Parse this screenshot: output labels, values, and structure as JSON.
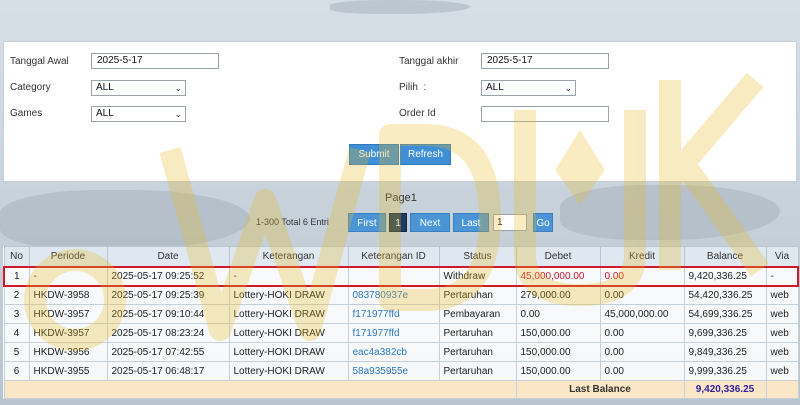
{
  "filters": {
    "start_date_label": "Tanggal Awal",
    "start_date_value": "2025-5-17",
    "end_date_label": "Tanggal akhir",
    "end_date_value": "2025-5-17",
    "category_label": "Category",
    "category_value": "ALL",
    "pilih_label": "Pilih  :",
    "pilih_value": "ALL",
    "games_label": "Games",
    "games_value": "ALL",
    "order_id_label": "Order Id",
    "order_id_value": "",
    "submit_label": "Submit",
    "refresh_label": "Refresh"
  },
  "pager": {
    "title": "Page1",
    "info": "1-300 Total 6 Entri",
    "first_label": "First",
    "current_page": "1",
    "next_label": "Next",
    "last_label": "Last",
    "goto_value": "1",
    "go_label": "Go"
  },
  "table": {
    "headers": [
      "No",
      "Periode",
      "Date",
      "Keterangan",
      "Keterangan ID",
      "Status",
      "Debet",
      "Kredit",
      "Balance",
      "Via"
    ],
    "rows": [
      [
        "1",
        "-",
        "2025-05-17 09:25:52",
        "-",
        "",
        "Withdraw",
        "45,000,000.00",
        "0.00",
        "9,420,336.25",
        "-"
      ],
      [
        "2",
        "HKDW-3958",
        "2025-05-17 09:25:39",
        "Lottery-HOKI DRAW",
        "083780937e",
        "Pertaruhan",
        "279,000.00",
        "0.00",
        "54,420,336.25",
        "web"
      ],
      [
        "3",
        "HKDW-3957",
        "2025-05-17 09:10:44",
        "Lottery-HOKI DRAW",
        "f171977ffd",
        "Pembayaran",
        "0.00",
        "45,000,000.00",
        "54,699,336.25",
        "web"
      ],
      [
        "4",
        "HKDW-3957",
        "2025-05-17 08:23:24",
        "Lottery-HOKI DRAW",
        "f171977ffd",
        "Pertaruhan",
        "150,000.00",
        "0.00",
        "9,699,336.25",
        "web"
      ],
      [
        "5",
        "HKDW-3956",
        "2025-05-17 07:42:55",
        "Lottery-HOKI DRAW",
        "eac4a382cb",
        "Pertaruhan",
        "150,000.00",
        "0.00",
        "9,849,336.25",
        "web"
      ],
      [
        "6",
        "HKDW-3955",
        "2025-05-17 06:48:17",
        "Lottery-HOKI DRAW",
        "58a935955e",
        "Pertaruhan",
        "150,000.00",
        "0.00",
        "9,999,336.25",
        "web"
      ]
    ],
    "last_balance_label": "Last Balance",
    "last_balance_value": "9,420,336.25"
  },
  "watermark": {
    "icon": "logo-watermark",
    "color": "#e8b923"
  },
  "colors": {
    "accent": "#3f8fd6",
    "highlight": "#d0192b",
    "link": "#2b78c2"
  }
}
